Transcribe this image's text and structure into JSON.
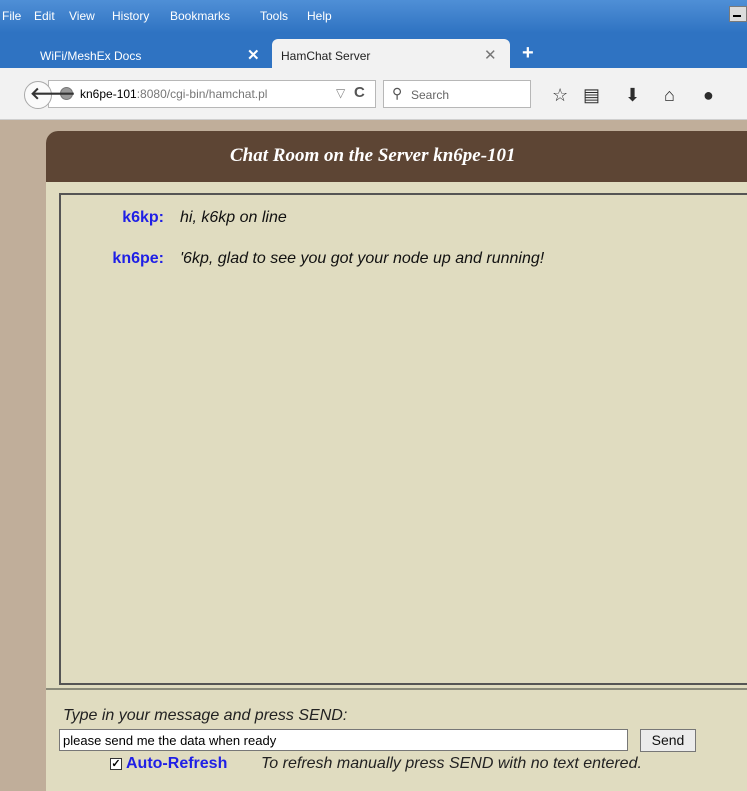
{
  "menubar": {
    "items": [
      "File",
      "Edit",
      "View",
      "History",
      "Bookmarks",
      "Tools",
      "Help"
    ]
  },
  "tabs": [
    {
      "label": "WiFi/MeshEx Docs",
      "close": "✕"
    },
    {
      "label": "HamChat Server",
      "close": "✕"
    }
  ],
  "new_tab": "+",
  "navbar": {
    "url_host": "kn6pe-101",
    "url_path": ":8080/cgi-bin/hamchat.pl",
    "search_placeholder": "Search"
  },
  "page": {
    "title": "Chat Room on the Server kn6pe-101",
    "messages": [
      {
        "nick": "k6kp:",
        "text": "hi, k6kp on line"
      },
      {
        "nick": "kn6pe:",
        "text": "'6kp, glad to see you got your node up and running!"
      }
    ],
    "prompt_label": "Type in your message and press SEND:",
    "message_value": "please send me the data when ready",
    "send_label": "Send",
    "auto_refresh_label": "Auto-Refresh",
    "auto_refresh_checked": true,
    "refresh_note": "To refresh manually press SEND with no text entered."
  },
  "colors": {
    "header_bg": "#5d4534",
    "panel_bg": "#e0dcc0",
    "nick_color": "#1f1fe6"
  }
}
